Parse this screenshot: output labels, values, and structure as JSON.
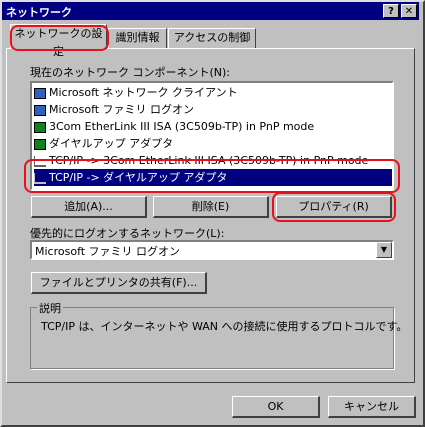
{
  "window": {
    "title": "ネットワーク",
    "help_label": "?",
    "close_label": "✕"
  },
  "tabs": [
    {
      "label": "ネットワークの設定",
      "active": true
    },
    {
      "label": "識別情報",
      "active": false
    },
    {
      "label": "アクセスの制御",
      "active": false
    }
  ],
  "components": {
    "label": "現在のネットワーク コンポーネント(N):",
    "items": [
      {
        "label": "Microsoft ネットワーク クライアント",
        "icon": "computer-icon",
        "selected": false
      },
      {
        "label": "Microsoft ファミリ ログオン",
        "icon": "computer-icon",
        "selected": false
      },
      {
        "label": "3Com EtherLink III ISA (3C509b-TP) in PnP mode",
        "icon": "network-card-icon",
        "selected": false
      },
      {
        "label": "ダイヤルアップ アダプタ",
        "icon": "network-card-icon",
        "selected": false
      },
      {
        "label": "TCP/IP -> 3Com EtherLink III ISA (3C509b-TP) in PnP mode",
        "icon": "protocol-icon",
        "selected": false
      },
      {
        "label": "TCP/IP -> ダイヤルアップ アダプタ",
        "icon": "protocol-icon",
        "selected": true
      }
    ]
  },
  "buttons": {
    "add": "追加(A)...",
    "remove": "削除(E)",
    "properties": "プロパティ(R)",
    "file_share": "ファイルとプリンタの共有(F)...",
    "ok": "OK",
    "cancel": "キャンセル"
  },
  "logon": {
    "label": "優先的にログオンするネットワーク(L):",
    "value": "Microsoft ファミリ ログオン"
  },
  "description": {
    "legend": "説明",
    "text": "TCP/IP は、インターネットや WAN への接続に使用するプロトコルです。"
  },
  "highlight_color": "#e8101a",
  "selection_color": "#000080"
}
